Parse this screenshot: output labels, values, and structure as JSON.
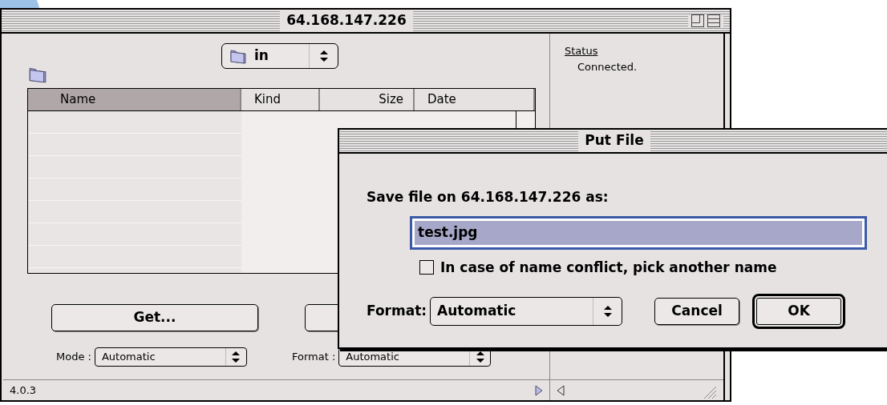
{
  "main_window": {
    "title": "64.168.147.226",
    "folder_popup": "in",
    "table": {
      "columns": [
        {
          "label": "Name",
          "selected": true
        },
        {
          "label": "Kind",
          "selected": false
        },
        {
          "label": "Size",
          "selected": false
        },
        {
          "label": "Date",
          "selected": false
        }
      ]
    },
    "get_button": "Get...",
    "mode": {
      "label": "Mode :",
      "value": "Automatic"
    },
    "format": {
      "label": "Format :",
      "value": "Automatic"
    },
    "version": "4.0.3",
    "status": {
      "heading": "Status",
      "text": "Connected."
    }
  },
  "dialog": {
    "title": "Put File",
    "prompt": "Save file on 64.168.147.226 as:",
    "filename": "test.jpg",
    "checkbox": {
      "label": "In case of name conflict, pick another name",
      "checked": false
    },
    "format": {
      "label": "Format:",
      "value": "Automatic"
    },
    "buttons": [
      {
        "label": "Cancel",
        "default": false
      },
      {
        "label": "OK",
        "default": true
      }
    ]
  }
}
